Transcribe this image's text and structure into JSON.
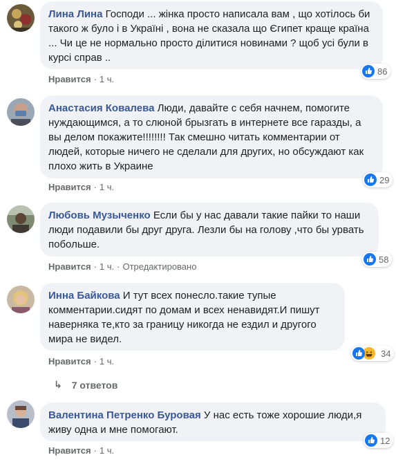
{
  "comments": [
    {
      "author": "Лина Лина",
      "text": "Господи ... жінка просто написала вам , що хотілось би такого ж було і в Україні , вона не сказала що Єгипет краще країна ... Чи це не нормально просто ділитися новинами ? щоб усі були в курсі справ ..",
      "like_label": "Нравится",
      "time": "1 ч.",
      "edited": "",
      "reactions_count": "86",
      "reactions": [
        "like-icon"
      ]
    },
    {
      "author": "Анастасия Ковалева",
      "text": "Люди, давайте с себя начнем, помогите нуждающимся, а то слюной брызгать в интернете все гаразды, а вы делом покажите!!!!!!!! Так смешно читать комментарии от людей, которые ничего не сделали для других, но обсуждают как плохо жить в Украине",
      "like_label": "Нравится",
      "time": "1 ч.",
      "edited": "",
      "reactions_count": "29",
      "reactions": [
        "like-icon"
      ]
    },
    {
      "author": "Любовь Музыченко",
      "text": "Если бы у нас давали такие пайки то наши люди подавили бы друг друга. Лезли бы на голову ,что бы урвать побольше.",
      "like_label": "Нравится",
      "time": "1 ч.",
      "edited": "Отредактировано",
      "reactions_count": "58",
      "reactions": [
        "like-icon"
      ]
    },
    {
      "author": "Инна Байкова",
      "text": "И тут всех понесло.такие тупые комментарии.сидят по домам и всех ненавидят.И пишут наверняка те,кто за границу никогда не ездил и другого мира не видел.",
      "like_label": "Нравится",
      "time": "1 ч.",
      "edited": "",
      "reactions_count": "34",
      "reactions": [
        "like-icon",
        "haha-icon"
      ]
    },
    {
      "author": "Валентина Петренко Буровая",
      "text": "У нас есть тоже хорошие люди,я живу одна и мне помогают.",
      "like_label": "Нравится",
      "time": "1 ч.",
      "edited": "",
      "reactions_count": "12",
      "reactions": [
        "like-icon"
      ]
    }
  ],
  "replies_link": "7 ответов",
  "colors": {
    "name": "#385898",
    "bubble": "#f0f2f5",
    "meta": "#65676b",
    "like": "#1877f2"
  }
}
